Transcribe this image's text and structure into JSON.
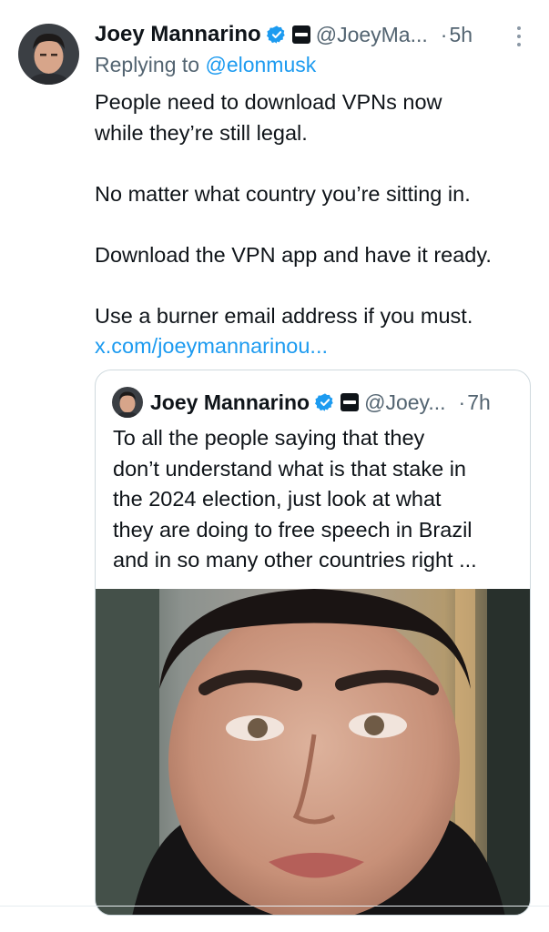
{
  "tweet": {
    "author_name": "Joey Mannarino",
    "handle": "@JoeyMa...",
    "time": "5h",
    "replying_prefix": "Replying to ",
    "replying_to": "@elonmusk",
    "lines": [
      "People need to download VPNs now",
      "while they’re still legal.",
      "No matter what country you’re sitting in.",
      "Download the VPN app and have it ready.",
      "Use a burner email address if you must."
    ],
    "link": "x.com/joeymannarinou..."
  },
  "quote": {
    "author_name": "Joey Mannarino",
    "handle": "@Joey...",
    "time": "7h",
    "lines": [
      "To all the people saying that they",
      "don’t understand what is that stake in",
      "the 2024 election, just look at what",
      "they are doing to free speech in Brazil",
      "and in so many other countries right ..."
    ]
  },
  "separator": "·",
  "colors": {
    "text": "#0f1419",
    "muted": "#536471",
    "accent": "#1d9bf0",
    "border": "#cfd9de"
  },
  "icons": [
    "verified-badge-icon",
    "affiliate-badge-icon",
    "more-options-icon"
  ]
}
